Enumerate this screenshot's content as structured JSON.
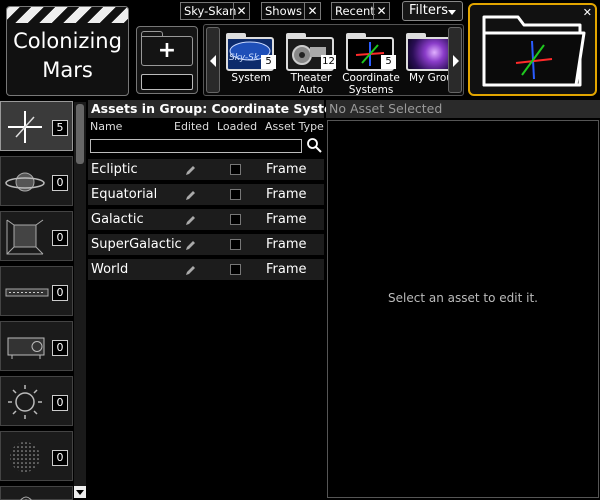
{
  "project": {
    "title_line1": "Colonizing",
    "title_line2": "Mars"
  },
  "filters": {
    "chips": [
      {
        "label": "Sky-Skan"
      },
      {
        "label": "Shows"
      },
      {
        "label": "Recent"
      }
    ],
    "button_label": "Filters"
  },
  "new_group": {
    "plus_label": "+",
    "name_value": ""
  },
  "groups": [
    {
      "label": "System",
      "count": "5",
      "thumb_text": "Sky-Sk"
    },
    {
      "label_line1": "Theater",
      "label_line2": "Auto",
      "count": "12"
    },
    {
      "label_line1": "Coordinate",
      "label_line2": "Systems",
      "count": "5"
    },
    {
      "label": "My Grou"
    }
  ],
  "categories": [
    {
      "name": "coordinate-systems",
      "count": "5"
    },
    {
      "name": "planets",
      "count": "0"
    },
    {
      "name": "models",
      "count": "0"
    },
    {
      "name": "displays",
      "count": "0"
    },
    {
      "name": "projectors",
      "count": "0"
    },
    {
      "name": "lights",
      "count": "0"
    },
    {
      "name": "particles",
      "count": "0"
    },
    {
      "name": "audio"
    }
  ],
  "assets_panel": {
    "title": "Assets in Group: Coordinate Systems",
    "columns": {
      "name": "Name",
      "edited": "Edited",
      "loaded": "Loaded",
      "type": "Asset Type"
    },
    "search_value": "",
    "rows": [
      {
        "name": "Ecliptic",
        "type": "Frame"
      },
      {
        "name": "Equatorial",
        "type": "Frame"
      },
      {
        "name": "Galactic",
        "type": "Frame"
      },
      {
        "name": "SuperGalactic",
        "type": "Frame"
      },
      {
        "name": "World",
        "type": "Frame"
      }
    ]
  },
  "editor_panel": {
    "title": "No Asset Selected",
    "message": "Select an asset to edit it."
  },
  "colors": {
    "accent": "#e2a500",
    "axis_x": "#ff2a2a",
    "axis_y": "#2a5cff",
    "axis_z": "#1ec81e"
  }
}
